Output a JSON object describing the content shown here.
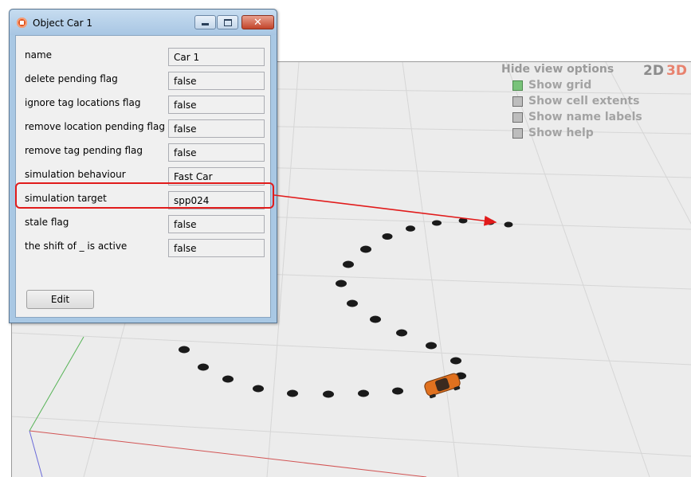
{
  "window": {
    "title": "Object Car 1",
    "controls": {
      "minimize": "minimize",
      "maximize": "maximize",
      "close": "✕"
    },
    "edit_label": "Edit"
  },
  "properties": [
    {
      "label": "name",
      "value": "Car 1"
    },
    {
      "label": "delete pending flag",
      "value": "false"
    },
    {
      "label": "ignore tag locations flag",
      "value": "false"
    },
    {
      "label": "remove location pending flag",
      "value": "false"
    },
    {
      "label": "remove tag pending flag",
      "value": "false"
    },
    {
      "label": "simulation behaviour",
      "value": "Fast Car"
    },
    {
      "label": "simulation target",
      "value": "spp024"
    },
    {
      "label": "stale flag",
      "value": "false"
    },
    {
      "label": "the shift of _ is active",
      "value": "false"
    }
  ],
  "view_options": {
    "title": "Hide view options",
    "mode_2d": "2D",
    "mode_3d": "3D",
    "options": [
      {
        "label": "Show grid",
        "checked": true
      },
      {
        "label": "Show cell extents",
        "checked": false
      },
      {
        "label": "Show name labels",
        "checked": false
      },
      {
        "label": "Show help",
        "checked": false
      }
    ]
  },
  "colors": {
    "highlight": "#e11b1b",
    "car": "#e0711f",
    "checked": "#79c37a"
  }
}
